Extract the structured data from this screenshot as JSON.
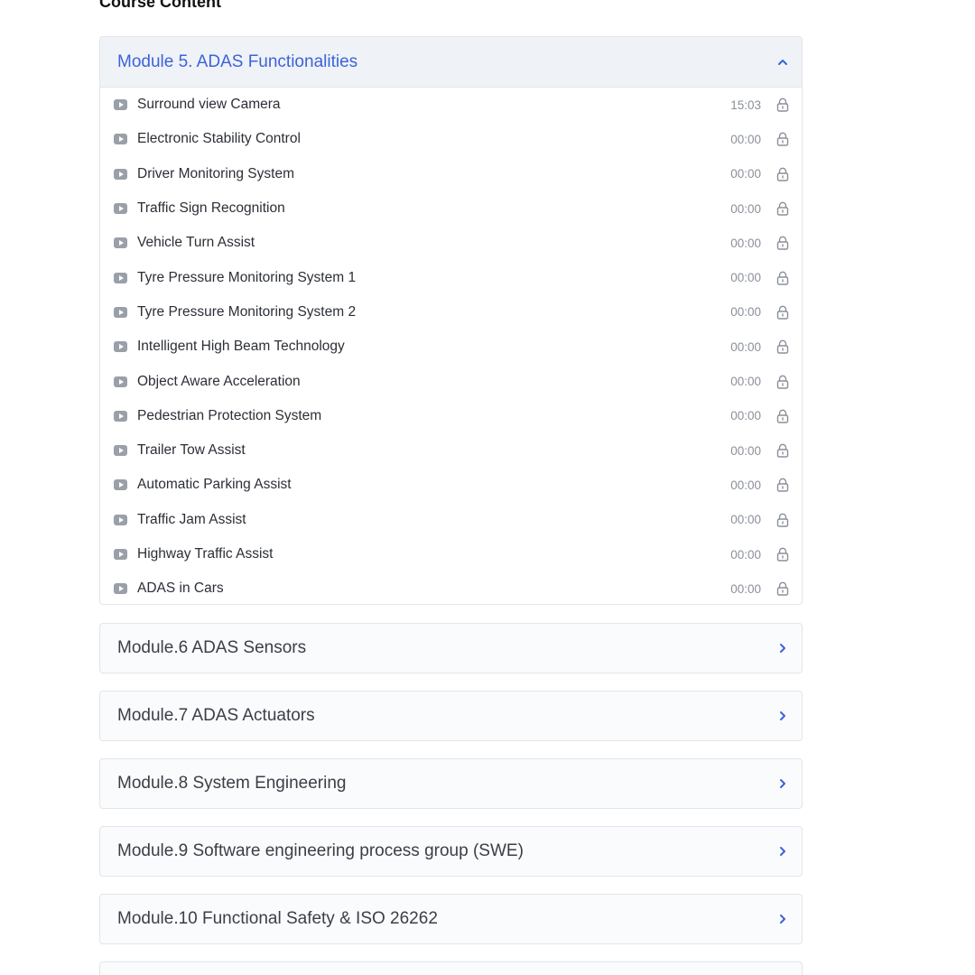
{
  "heading": "Course Content",
  "accent_color": "#3d63d9",
  "open_module": {
    "title": "Module 5. ADAS Functionalities",
    "toggle_icon": "chevron-up-icon",
    "lessons": [
      {
        "title": "Surround view Camera",
        "duration": "15:03",
        "icon": "play-video-icon",
        "locked": true
      },
      {
        "title": "Electronic Stability Control",
        "duration": "00:00",
        "icon": "play-video-icon",
        "locked": true
      },
      {
        "title": "Driver Monitoring System",
        "duration": "00:00",
        "icon": "play-video-icon",
        "locked": true
      },
      {
        "title": "Traffic Sign Recognition",
        "duration": "00:00",
        "icon": "play-video-icon",
        "locked": true
      },
      {
        "title": "Vehicle Turn Assist",
        "duration": "00:00",
        "icon": "play-video-icon",
        "locked": true
      },
      {
        "title": "Tyre Pressure Monitoring System 1",
        "duration": "00:00",
        "icon": "play-video-icon",
        "locked": true
      },
      {
        "title": "Tyre Pressure Monitoring System 2",
        "duration": "00:00",
        "icon": "play-video-icon",
        "locked": true
      },
      {
        "title": "Intelligent High Beam Technology",
        "duration": "00:00",
        "icon": "play-video-icon",
        "locked": true
      },
      {
        "title": "Object Aware Acceleration",
        "duration": "00:00",
        "icon": "play-video-icon",
        "locked": true
      },
      {
        "title": "Pedestrian Protection System",
        "duration": "00:00",
        "icon": "play-video-icon",
        "locked": true
      },
      {
        "title": "Trailer Tow Assist",
        "duration": "00:00",
        "icon": "play-video-icon",
        "locked": true
      },
      {
        "title": "Automatic Parking Assist",
        "duration": "00:00",
        "icon": "play-video-icon",
        "locked": true
      },
      {
        "title": "Traffic Jam Assist",
        "duration": "00:00",
        "icon": "play-video-icon",
        "locked": true
      },
      {
        "title": "Highway Traffic Assist",
        "duration": "00:00",
        "icon": "play-video-icon",
        "locked": true
      },
      {
        "title": "ADAS in Cars",
        "duration": "00:00",
        "icon": "play-video-icon",
        "locked": true
      }
    ]
  },
  "collapsed_modules": [
    {
      "title": "Module.6 ADAS Sensors",
      "toggle_icon": "chevron-right-icon"
    },
    {
      "title": "Module.7 ADAS Actuators",
      "toggle_icon": "chevron-right-icon"
    },
    {
      "title": "Module.8 System Engineering",
      "toggle_icon": "chevron-right-icon"
    },
    {
      "title": "Module.9 Software engineering process group (SWE)",
      "toggle_icon": "chevron-right-icon"
    },
    {
      "title": "Module.10 Functional Safety & ISO 26262",
      "toggle_icon": "chevron-right-icon"
    }
  ]
}
